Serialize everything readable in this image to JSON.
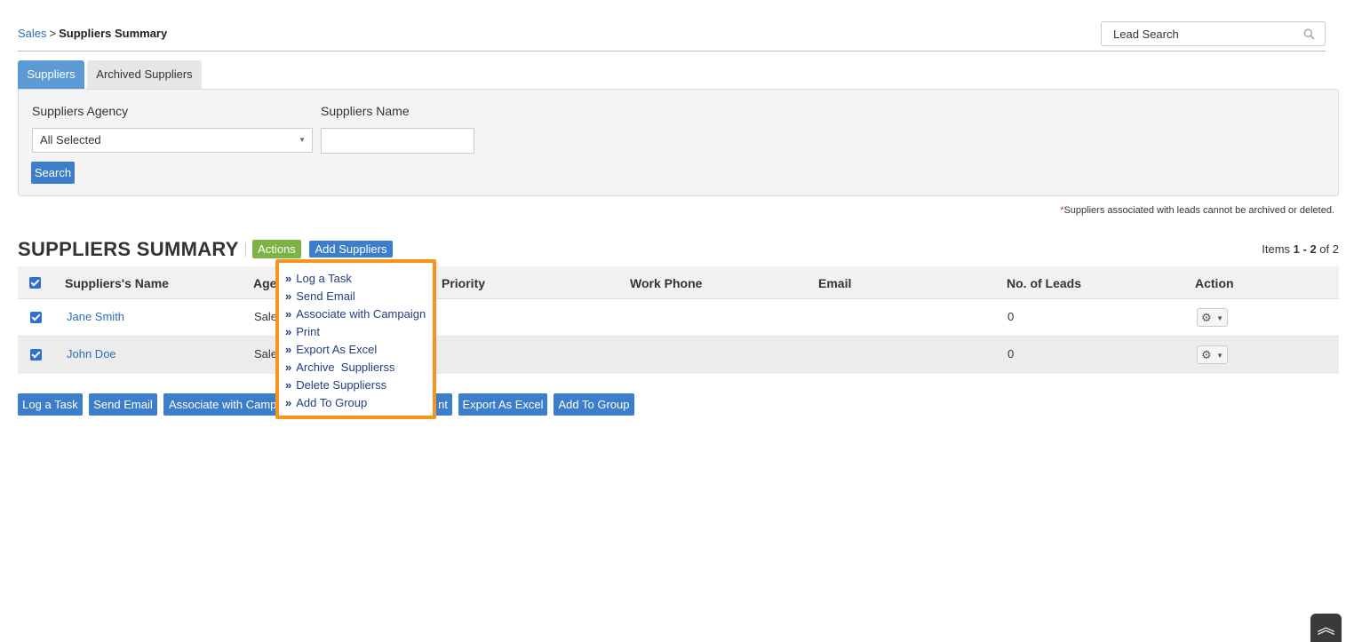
{
  "breadcrumb": {
    "parent": "Sales",
    "separator": ">",
    "current": "Suppliers Summary"
  },
  "lead_search": {
    "placeholder": "Lead Search"
  },
  "tabs": [
    {
      "label": "Suppliers",
      "active": true
    },
    {
      "label": "Archived Suppliers",
      "active": false
    }
  ],
  "filters": {
    "agency_label": "Suppliers Agency",
    "agency_value": "All Selected",
    "name_label": "Suppliers Name",
    "name_value": "",
    "search_label": "Search"
  },
  "note": {
    "star": "*",
    "text": "Suppliers associated with leads cannot be archived or deleted."
  },
  "summary": {
    "title": "SUPPLIERS SUMMARY",
    "actions_label": "Actions",
    "add_label": "Add Suppliers",
    "items_prefix": "Items",
    "items_range": "1 - 2",
    "items_of": "of",
    "items_total": "2"
  },
  "table": {
    "columns": [
      "Suppliers's Name",
      "Age",
      "Priority",
      "Work Phone",
      "Email",
      "No. of Leads",
      "Action"
    ],
    "rows": [
      {
        "name": "Jane Smith",
        "agency": "Sale",
        "leads": "0"
      },
      {
        "name": "John Doe",
        "agency": "Sale",
        "leads": "0"
      }
    ]
  },
  "actions_menu": {
    "bullet": "»",
    "items": [
      "Log a Task",
      "Send Email",
      "Associate with Campaign",
      "Print",
      "Export As Excel",
      "Archive  Supplierss",
      "Delete Supplierss",
      "Add To Group"
    ]
  },
  "bottom_buttons": [
    "Log a Task",
    "Send Email",
    "Associate with Camp",
    "nt",
    "Export As Excel",
    "Add To Group"
  ],
  "colors": {
    "primary": "#3c7ec9",
    "actions_green": "#7cb342",
    "highlight_orange": "#f7941d",
    "link": "#2d6fb6"
  },
  "icons": {
    "search": "search-icon",
    "gear": "gear-icon",
    "scroll": "double-chevron-up-icon"
  }
}
